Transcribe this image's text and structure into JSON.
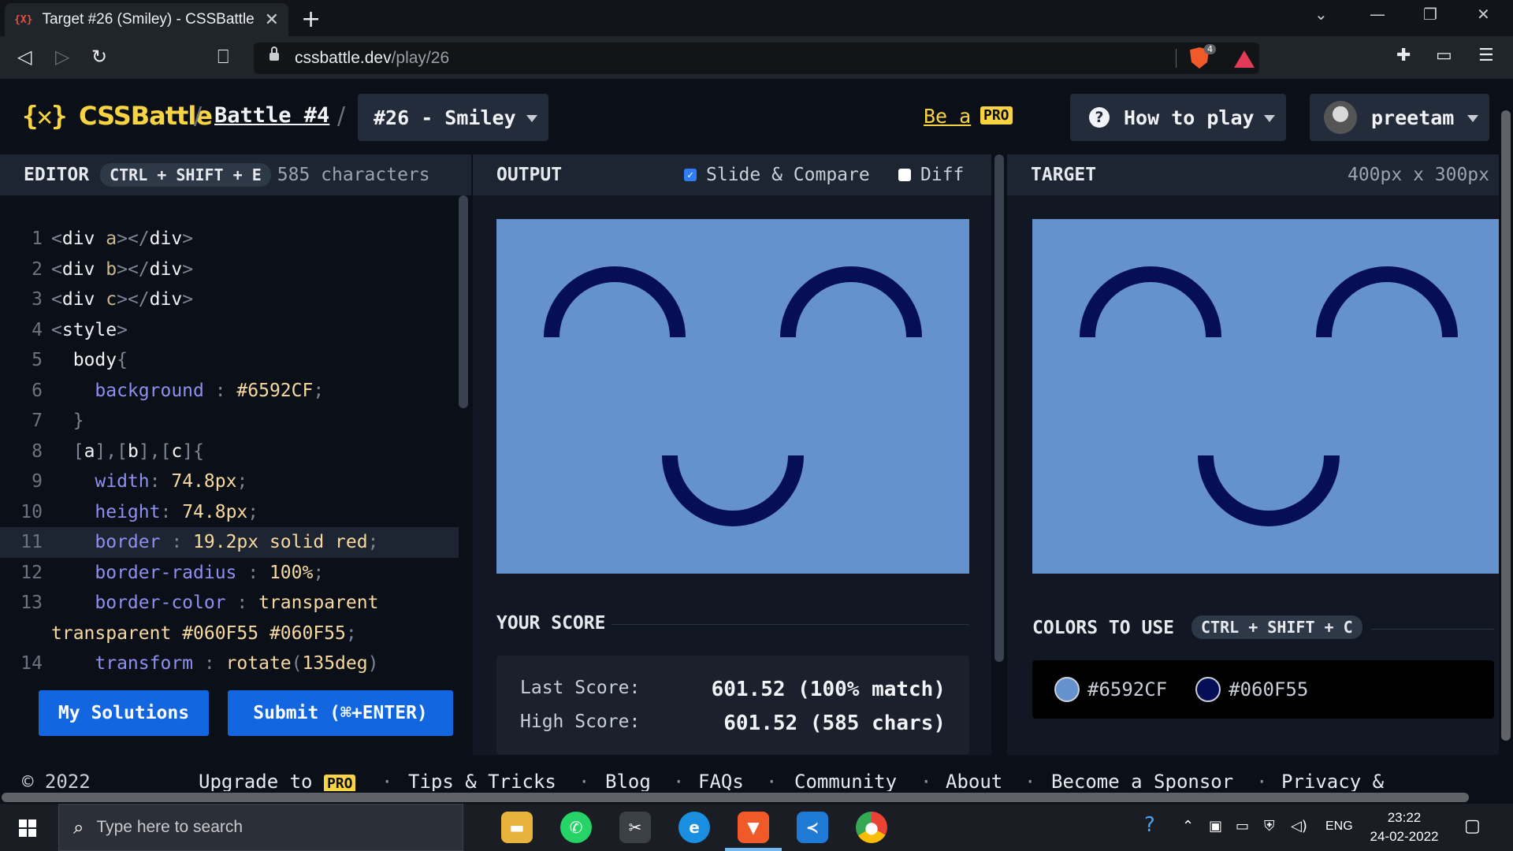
{
  "browser": {
    "tab_favicon": "{X}",
    "tab_title": "Target #26 (Smiley) - CSSBattle",
    "tab_close": "✕",
    "new_tab": "+",
    "url_host": "cssbattle.dev",
    "url_path": "/play/26",
    "shield_count": "4",
    "window_controls": [
      "⌄",
      "—",
      "❐",
      "✕"
    ]
  },
  "header": {
    "logo_mark": "{✕}",
    "logo_text": "CSSBattle",
    "crumb_sep": "/",
    "battle": "Battle #4",
    "target_label": "#26 - Smiley",
    "be_a": "Be a",
    "pro": "PRO",
    "help_icon": "?",
    "how_to_play": "How to play",
    "username": "preetam"
  },
  "editor": {
    "title": "EDITOR",
    "shortcut": "CTRL + SHIFT + E",
    "chars": "585 characters",
    "lines": [
      {
        "n": "1",
        "html": [
          [
            "pt",
            "<"
          ],
          [
            "tg",
            "div"
          ],
          [
            "at",
            " a"
          ],
          [
            "pt",
            "></"
          ],
          [
            "tg",
            "div"
          ],
          [
            "pt",
            ">"
          ]
        ]
      },
      {
        "n": "2",
        "html": [
          [
            "pt",
            "<"
          ],
          [
            "tg",
            "div"
          ],
          [
            "at",
            " b"
          ],
          [
            "pt",
            "></"
          ],
          [
            "tg",
            "div"
          ],
          [
            "pt",
            ">"
          ]
        ]
      },
      {
        "n": "3",
        "html": [
          [
            "pt",
            "<"
          ],
          [
            "tg",
            "div"
          ],
          [
            "at",
            " c"
          ],
          [
            "pt",
            "></"
          ],
          [
            "tg",
            "div"
          ],
          [
            "pt",
            ">"
          ]
        ]
      },
      {
        "n": "4",
        "html": [
          [
            "pt",
            "<"
          ],
          [
            "tg",
            "style"
          ],
          [
            "pt",
            ">"
          ]
        ]
      },
      {
        "n": "5",
        "html": [
          [
            "tg",
            "  body"
          ],
          [
            "pt",
            "{"
          ]
        ]
      },
      {
        "n": "6",
        "html": [
          [
            "pr",
            "    background"
          ],
          [
            "pt",
            " : "
          ],
          [
            "vl",
            "#6592CF"
          ],
          [
            "pt",
            ";"
          ]
        ]
      },
      {
        "n": "7",
        "html": [
          [
            "pt",
            "  }"
          ]
        ]
      },
      {
        "n": "8",
        "html": [
          [
            "pt",
            "  ["
          ],
          [
            "tg",
            "a"
          ],
          [
            "pt",
            "],["
          ],
          [
            "tg",
            "b"
          ],
          [
            "pt",
            "],["
          ],
          [
            "tg",
            "c"
          ],
          [
            "pt",
            "]{"
          ]
        ]
      },
      {
        "n": "9",
        "html": [
          [
            "pr",
            "    width"
          ],
          [
            "pt",
            ": "
          ],
          [
            "vl",
            "74.8px"
          ],
          [
            "pt",
            ";"
          ]
        ]
      },
      {
        "n": "10",
        "html": [
          [
            "pr",
            "    height"
          ],
          [
            "pt",
            ": "
          ],
          [
            "vl",
            "74.8px"
          ],
          [
            "pt",
            ";"
          ]
        ]
      },
      {
        "n": "11",
        "html": [
          [
            "pr",
            "    border"
          ],
          [
            "pt",
            " : "
          ],
          [
            "vl",
            "19.2px solid red"
          ],
          [
            "pt",
            ";"
          ]
        ],
        "active": true
      },
      {
        "n": "12",
        "html": [
          [
            "pr",
            "    border-radius"
          ],
          [
            "pt",
            " : "
          ],
          [
            "vl",
            "100%"
          ],
          [
            "pt",
            ";"
          ]
        ]
      },
      {
        "n": "13",
        "html": [
          [
            "pr",
            "    border-color"
          ],
          [
            "pt",
            " : "
          ],
          [
            "vl",
            "transparent transparent #060F55 #060F55"
          ],
          [
            "pt",
            ";"
          ]
        ],
        "wrapped": true
      },
      {
        "n": "14",
        "html": [
          [
            "pr",
            "    transform"
          ],
          [
            "pt",
            " : "
          ],
          [
            "vl",
            "rotate"
          ],
          [
            "pt",
            "("
          ],
          [
            "vl",
            "135deg"
          ],
          [
            "pt",
            ")"
          ]
        ]
      }
    ],
    "my_solutions": "My Solutions",
    "submit": "Submit (⌘+ENTER)"
  },
  "output": {
    "title": "OUTPUT",
    "slide_compare": "Slide & Compare",
    "slide_checked": true,
    "diff": "Diff",
    "diff_checked": false,
    "your_score": "YOUR SCORE",
    "last_score_label": "Last Score:",
    "last_score": "601.52 (100% match)",
    "high_score_label": "High Score:",
    "high_score": "601.52 (585 chars)"
  },
  "target": {
    "title": "TARGET",
    "dimensions": "400px x 300px",
    "colors_title": "COLORS TO USE",
    "colors_shortcut": "CTRL + SHIFT + C",
    "colors": [
      {
        "hex": "#6592CF"
      },
      {
        "hex": "#060F55"
      }
    ]
  },
  "footer": {
    "copyright": "© 2022",
    "upgrade": "Upgrade to",
    "pro": "PRO",
    "tips": "Tips & Tricks",
    "blog": "Blog",
    "faqs": "FAQs",
    "community": "Community",
    "about": "About",
    "sponsor": "Become a Sponsor",
    "privacy": "Privacy &",
    "dot": "·"
  },
  "taskbar": {
    "search_placeholder": "Type here to search",
    "tray_lang": "ENG",
    "time": "23:22",
    "date": "24-02-2022"
  },
  "palette": {
    "bg": "#6592CF",
    "fg": "#060F55"
  }
}
